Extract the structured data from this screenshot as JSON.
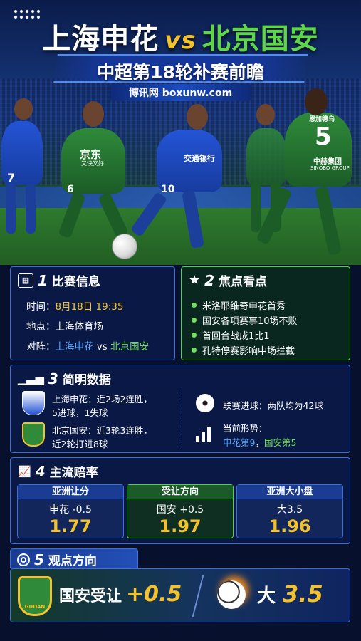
{
  "header": {
    "home_team": "上海申花",
    "vs": "vs",
    "away_team": "北京国安",
    "subtitle": "中超第18轮补赛前瞻",
    "site": "博讯网 boxunw.com"
  },
  "hero": {
    "jersey_home_sponsor": "京东",
    "jersey_home_sub": "又快又好",
    "jersey_shenhua_sponsor": "交通银行",
    "jersey_number_left": "7",
    "jersey_number_6": "6",
    "jersey_number_10": "10",
    "jersey_number_5": "5",
    "jersey_sponsor_right": "中赫集团",
    "jersey_sponsor_right_sub": "SINOBO GROUP",
    "jersey_name_right": "恩加德乌"
  },
  "match_info": {
    "number": "1",
    "title": "比赛信息",
    "time_label": "时间：",
    "time_value": "8月18日 19:35",
    "venue_label": "地点：",
    "venue_value": "上海体育场",
    "matchup_label": "对阵：",
    "matchup_home": "上海申花",
    "matchup_vs": "vs",
    "matchup_away": "北京国安"
  },
  "focus": {
    "number": "2",
    "title": "焦点看点",
    "items": [
      "米洛耶维奇申花首秀",
      "国安各项赛事10场不败",
      "首回合战成1比1",
      "孔特停赛影响中场拦截"
    ]
  },
  "stats": {
    "number": "3",
    "title": "简明数据",
    "home_line1": "上海申花：近2场2连胜，",
    "home_line2": "5进球，1失球",
    "away_line1": "北京国安：近3轮3连胜，",
    "away_line2": "近2轮打进8球",
    "goals_text": "联赛进球：两队均为42球",
    "form_label": "当前形势：",
    "form_home": "申花第9",
    "form_sep": "，",
    "form_away": "国安第5"
  },
  "odds": {
    "number": "4",
    "title": "主流赔率",
    "boxes": [
      {
        "head": "亚洲让分",
        "line": "申花 -0.5",
        "value": "1.77"
      },
      {
        "head": "受让方向",
        "line": "国安 +0.5",
        "value": "1.97"
      },
      {
        "head": "亚洲大小盘",
        "line": "大3.5",
        "value": "1.96"
      }
    ]
  },
  "view": {
    "number": "5",
    "title": "观点方向",
    "pick1_text": "国安受让",
    "pick1_value": "+0.5",
    "pick2_text": "大",
    "pick2_value": "3.5",
    "badge_text": "GUOAN"
  },
  "colors": {
    "accent_yellow": "#f3c12b",
    "home_blue": "#5aa9ff",
    "away_green": "#6ee05a",
    "border_blue": "#3d6fd6"
  }
}
